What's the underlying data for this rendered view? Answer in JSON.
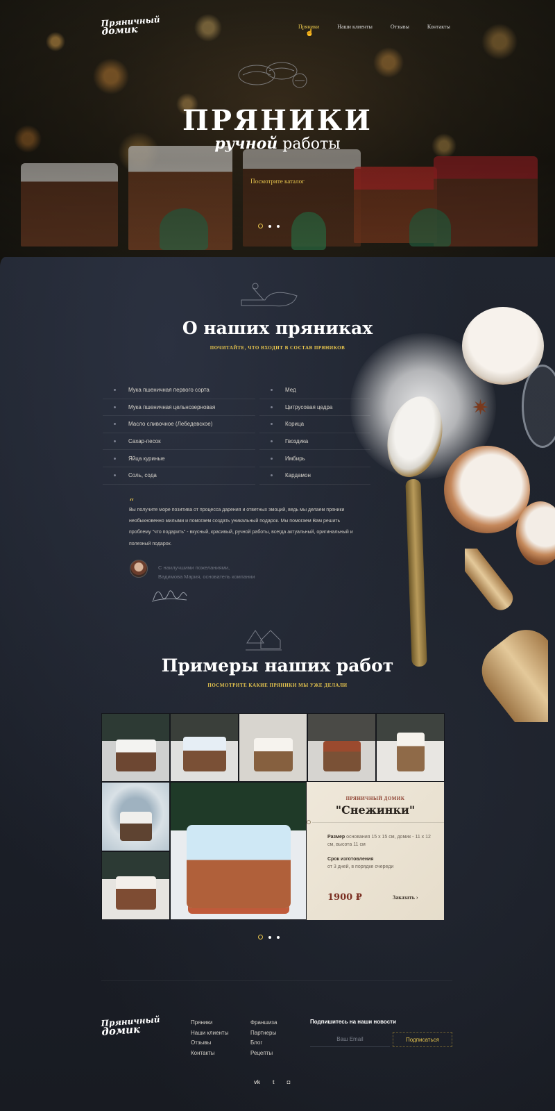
{
  "brand": {
    "logo_line1": "Пряничный",
    "logo_line2": "домик"
  },
  "nav": [
    {
      "label": "Пряники",
      "active": true
    },
    {
      "label": "Наши клиенты",
      "active": false
    },
    {
      "label": "Отзывы",
      "active": false
    },
    {
      "label": "Контакты",
      "active": false
    }
  ],
  "hero": {
    "title": "ПРЯНИКИ",
    "subtitle_italic": "ручной",
    "subtitle_rest": "работы",
    "cta": "Посмотрите каталог",
    "slides": 3,
    "active_slide": 0
  },
  "about": {
    "title": "О наших пряниках",
    "subtitle": "ПОЧИТАЙТЕ, ЧТО ВХОДИТ В СОСТАВ ПРЯНИКОВ",
    "ingredients_left": [
      "Мука пшеничная первого сорта",
      "Мука пшеничная цельнозерновая",
      "Масло сливочное (Лебедевское)",
      "Сахар-песок",
      "Яйца куриные",
      "Соль, сода"
    ],
    "ingredients_right": [
      "Мед",
      "Цитрусовая цедра",
      "Корица",
      "Гвоздика",
      "Имбирь",
      "Кардамон"
    ],
    "quote_mark": "“",
    "quote": "Вы получите море позитива от процесса дарения и ответных эмоций, ведь мы делаем пряники необыкновенно милыми и помогаем создать уникальный подарок. Мы помогаем Вам решить проблему \"что подарить\" - вкусный, красивый, ручной работы, всегда актуальный, оригинальный и полезный подарок.",
    "author_line1": "С наилучшими пожеланиями,",
    "author_line2": "Вадимова Мария, основатель компании"
  },
  "works": {
    "title": "Примеры наших работ",
    "subtitle": "ПОСМОТРИТЕ КАКИЕ ПРЯНИКИ МЫ УЖЕ ДЕЛАЛИ",
    "card": {
      "kicker": "ПРЯНИЧНЫЙ ДОМИК",
      "name": "\"Снежинки\"",
      "size_label": "Размер",
      "size_text": "основания 15 х 15 см, домик - 11 х 12 см, высота 11 см",
      "time_label": "Срок изготовления",
      "time_text": "от 3 дней, в порядке очереди",
      "price": "1900 ₽",
      "order": "Заказать ›"
    },
    "slides": 3,
    "active_slide": 0
  },
  "footer": {
    "logo_line1": "Пряничный",
    "logo_line2": "домик",
    "col1": [
      "Пряники",
      "Наши клиенты",
      "Отзывы",
      "Контакты"
    ],
    "col2": [
      "Франшиза",
      "Партнеры",
      "Блог",
      "Рецепты"
    ],
    "newsletter_title": "Подпишитесь на наши новости",
    "email_placeholder": "Ваш Email",
    "subscribe": "Подписаться",
    "socials": [
      "vk",
      "twitter-icon",
      "instagram-icon"
    ],
    "social_labels": [
      "vk",
      "t",
      "◘"
    ]
  },
  "colors": {
    "accent": "#e8c64e",
    "board": "#1e222b",
    "card": "#ece4d4",
    "price": "#7a2f22"
  }
}
